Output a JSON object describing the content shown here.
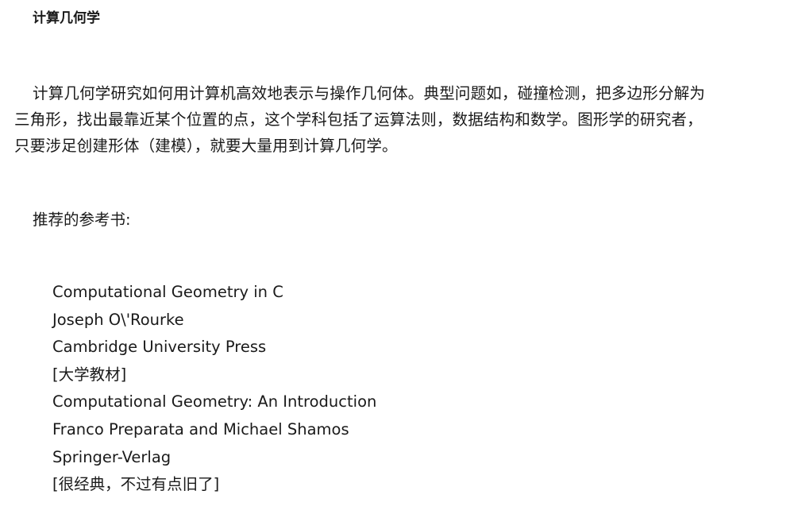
{
  "page": {
    "title": "计算几何学"
  },
  "intro": {
    "lines": [
      "计算几何学研究如何用计算机高效地表示与操作几何体。典型问题如，碰撞检测，把多边形分解为",
      "三角形，找出最靠近某个位置的点，这个学科包括了运算法则，数据结构和数学。图形学的研究者，",
      "只要涉足创建形体（建模），就要大量用到计算几何学。"
    ]
  },
  "references": {
    "heading": "推荐的参考书:",
    "lines": [
      "Computational Geometry in C",
      "Joseph O\\'Rourke",
      "Cambridge University Press",
      "[大学教材]",
      "Computational Geometry: An Introduction",
      "Franco Preparata and Michael Shamos",
      "Springer-Verlag",
      "[很经典，不过有点旧了]"
    ]
  }
}
